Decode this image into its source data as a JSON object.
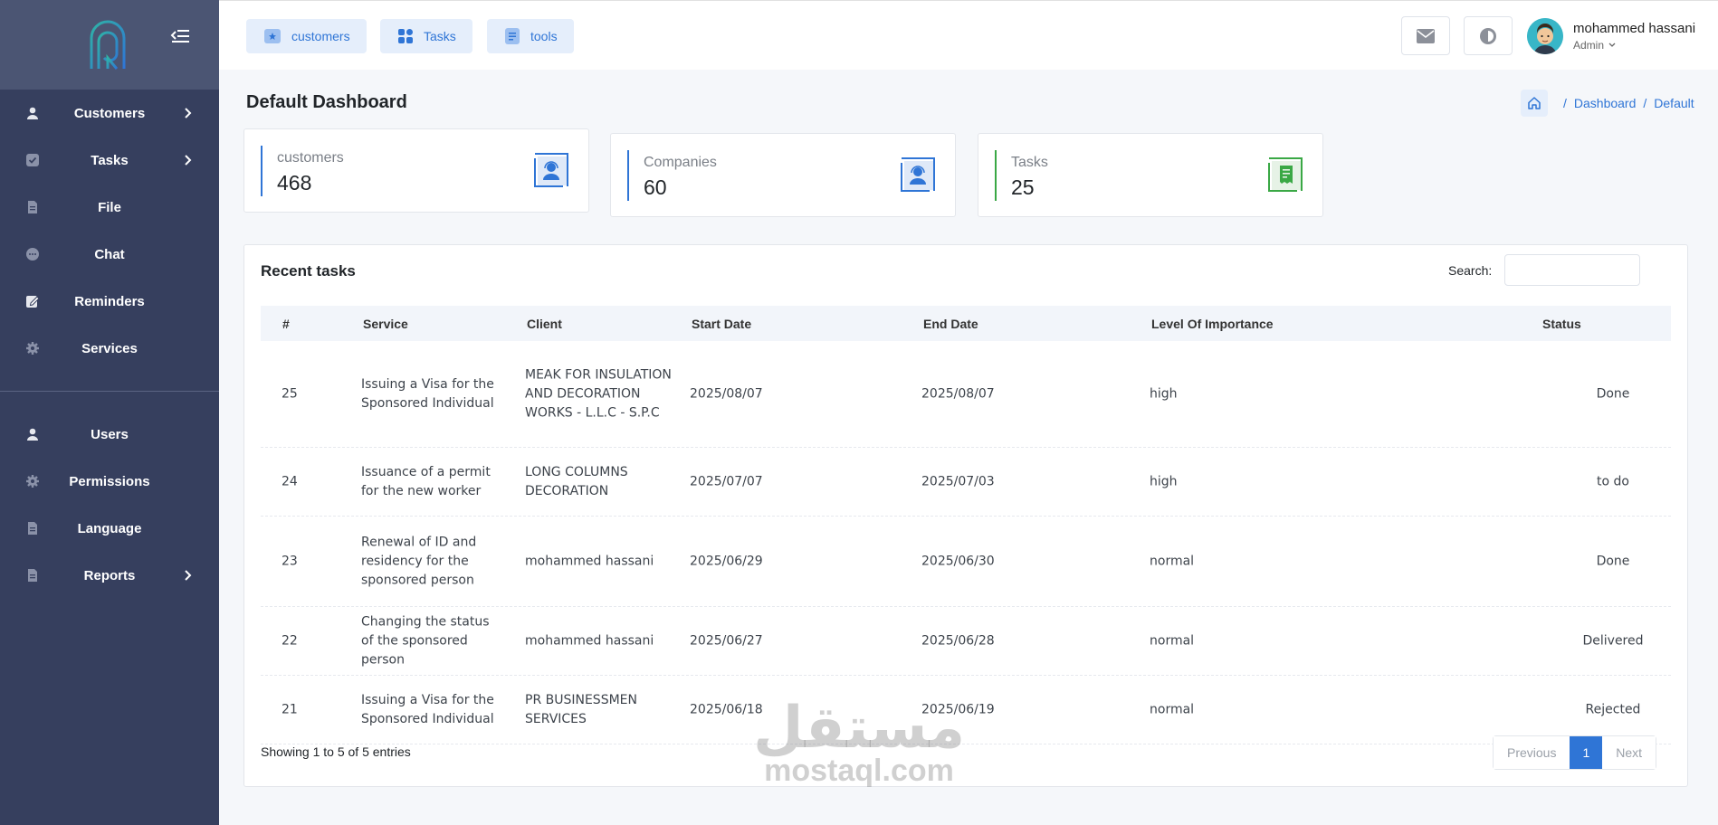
{
  "sidebar": {
    "logo": "app-logo",
    "items": [
      {
        "label": "Customers",
        "icon": "user-icon",
        "chevron": true
      },
      {
        "label": "Tasks",
        "icon": "check-square-icon",
        "chevron": true
      },
      {
        "label": "File",
        "icon": "file-icon",
        "chevron": false
      },
      {
        "label": "Chat",
        "icon": "chat-icon",
        "chevron": false
      },
      {
        "label": "Reminders",
        "icon": "edit-icon",
        "chevron": false
      },
      {
        "label": "Services",
        "icon": "gear-icon",
        "chevron": false
      }
    ],
    "items2": [
      {
        "label": "Users",
        "icon": "user-icon",
        "chevron": false
      },
      {
        "label": "Permissions",
        "icon": "gear-icon",
        "chevron": false
      },
      {
        "label": "Language",
        "icon": "file-icon",
        "chevron": false
      },
      {
        "label": "Reports",
        "icon": "file-icon",
        "chevron": true
      }
    ]
  },
  "topbar": {
    "quick_links": [
      {
        "label": "customers",
        "icon": "star-card-icon"
      },
      {
        "label": "Tasks",
        "icon": "grid-icon"
      },
      {
        "label": "tools",
        "icon": "document-icon"
      }
    ],
    "user": {
      "name": "mohammed hassani",
      "role": "Admin"
    }
  },
  "page": {
    "title": "Default Dashboard",
    "breadcrumb": [
      "Dashboard",
      "Default"
    ]
  },
  "stats": [
    {
      "label": "customers",
      "value": "468",
      "color": "#2f75d6"
    },
    {
      "label": "Companies",
      "value": "60",
      "color": "#2f75d6"
    },
    {
      "label": "Tasks",
      "value": "25",
      "color": "#3aa845"
    }
  ],
  "recent_tasks": {
    "title": "Recent tasks",
    "search_label": "Search:",
    "search_value": "",
    "columns": [
      "#",
      "Service",
      "Client",
      "Start Date",
      "End Date",
      "Level Of Importance",
      "Status"
    ],
    "rows": [
      {
        "id": "25",
        "service": "Issuing a Visa for the Sponsored Individual",
        "client": "MEAK FOR INSULATION AND DECORATION WORKS - L.L.C - S.P.C",
        "start": "2025/08/07",
        "end": "2025/08/07",
        "level": "high",
        "status": "Done"
      },
      {
        "id": "24",
        "service": "Issuance of a permit for the new worker",
        "client": "LONG COLUMNS DECORATION",
        "start": "2025/07/07",
        "end": "2025/07/03",
        "level": "high",
        "status": "to do"
      },
      {
        "id": "23",
        "service": "Renewal of ID and residency for the sponsored person",
        "client": "mohammed hassani",
        "start": "2025/06/29",
        "end": "2025/06/30",
        "level": "normal",
        "status": "Done"
      },
      {
        "id": "22",
        "service": "Changing the status of the sponsored person",
        "client": "mohammed hassani",
        "start": "2025/06/27",
        "end": "2025/06/28",
        "level": "normal",
        "status": "Delivered"
      },
      {
        "id": "21",
        "service": "Issuing a Visa for the Sponsored Individual",
        "client": "PR BUSINESSMEN SERVICES",
        "start": "2025/06/18",
        "end": "2025/06/19",
        "level": "normal",
        "status": "Rejected"
      }
    ],
    "showing": "Showing 1 to 5 of 5 entries",
    "pagination": {
      "previous": "Previous",
      "current": "1",
      "next": "Next"
    }
  },
  "watermark": {
    "arabic": "مستقل",
    "latin": "mostaql.com"
  }
}
